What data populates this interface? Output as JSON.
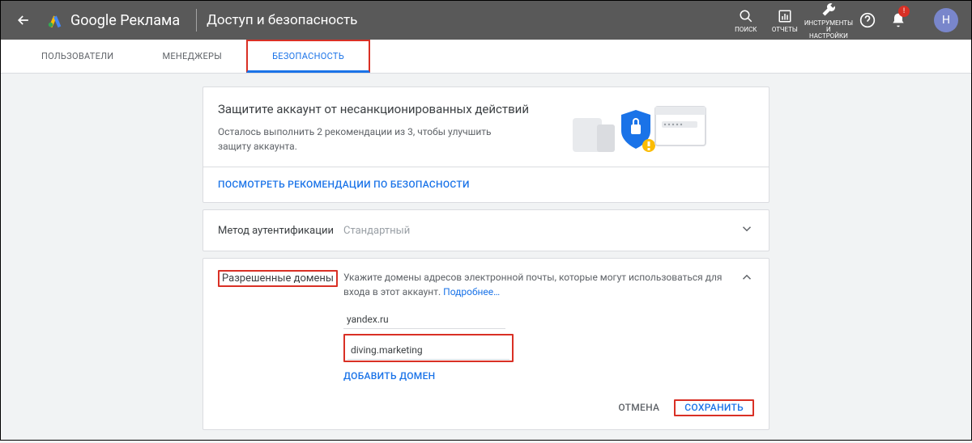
{
  "header": {
    "product": "Google Реклама",
    "page_title": "Доступ и безопасность",
    "tools": {
      "search": "ПОИСК",
      "reports": "ОТЧЕТЫ",
      "settings": "ИНСТРУМЕНТЫ\nИ\nНАСТРОЙКИ"
    },
    "notification_badge": "!",
    "avatar_initial": "Н"
  },
  "tabs": {
    "users": "ПОЛЬЗОВАТЕЛИ",
    "managers": "МЕНЕДЖЕРЫ",
    "security": "БЕЗОПАСНОСТЬ"
  },
  "security_card": {
    "title": "Защитите аккаунт от несанкционированных действий",
    "subtitle": "Осталось выполнить 2 рекомендации из 3, чтобы улучшить защиту аккаунта.",
    "action": "ПОСМОТРЕТЬ РЕКОМЕНДАЦИИ ПО БЕЗОПАСНОСТИ"
  },
  "auth_method": {
    "label": "Метод аутентификации",
    "value": "Стандартный"
  },
  "domains": {
    "label": "Разрешенные домены",
    "description": "Укажите домены адресов электронной почты, которые могут использоваться для входа в этот аккаунт. ",
    "more_link": "Подробнее…",
    "list": {
      "0": "yandex.ru",
      "1": "diving.marketing"
    },
    "add": "ДОБАВИТЬ ДОМЕН",
    "cancel": "ОТМЕНА",
    "save": "СОХРАНИТЬ"
  }
}
